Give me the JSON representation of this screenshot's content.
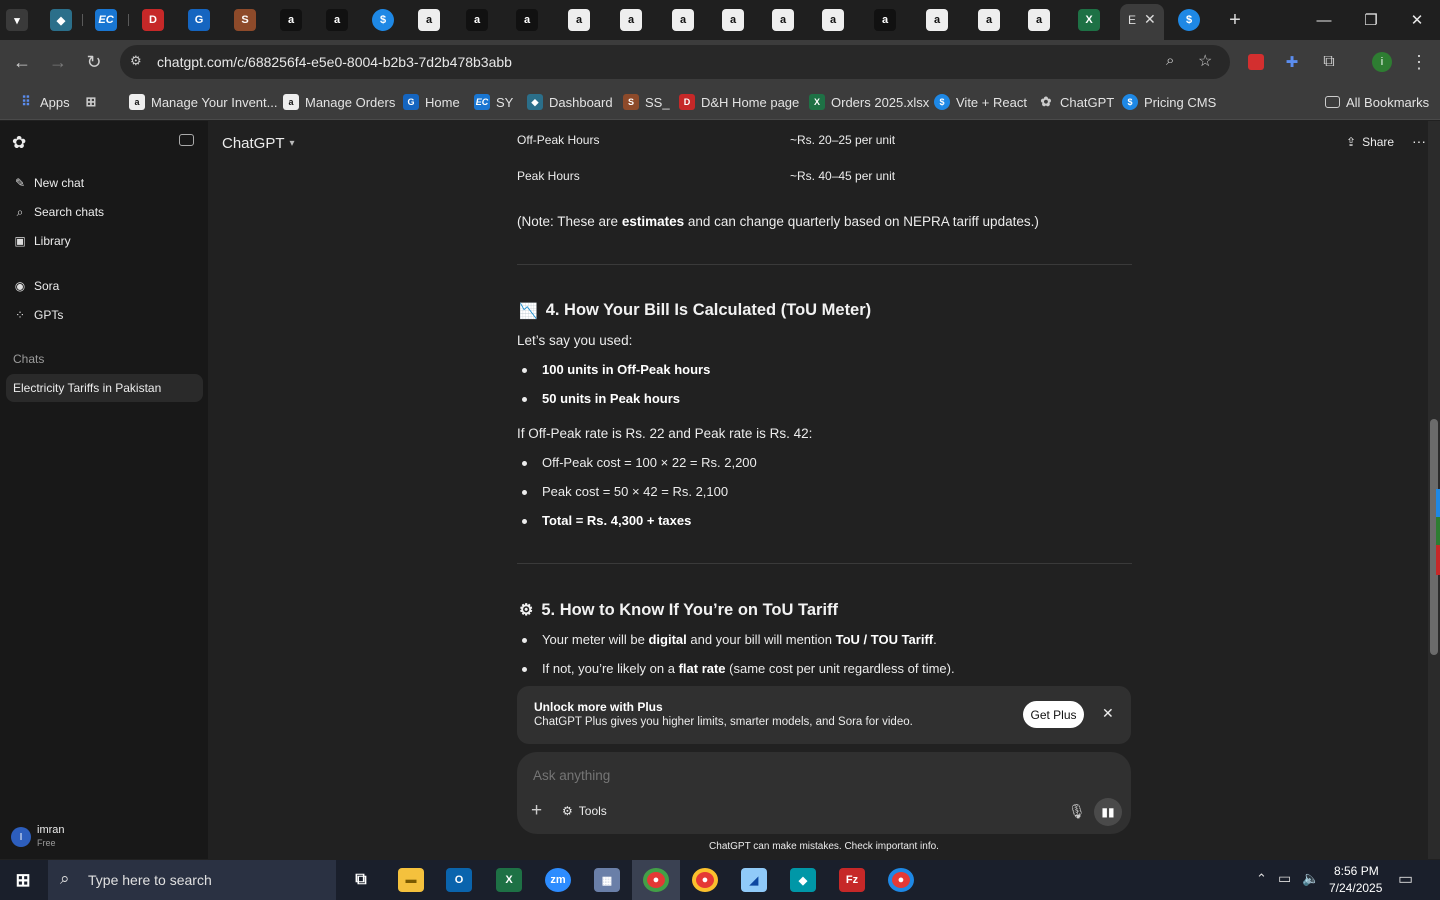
{
  "browser": {
    "url": "chatgpt.com/c/688256f4-e5e0-8004-b2b3-7d2b478b3abb",
    "active_tab_label": "E",
    "bookmarks": [
      {
        "label": "Apps",
        "icon": "apps-grid-icon"
      },
      {
        "label": "",
        "icon": "tab-groups-icon"
      },
      {
        "label": "Manage Your Invent...",
        "icon": "amazon-icon"
      },
      {
        "label": "Manage Orders",
        "icon": "amazon-icon"
      },
      {
        "label": "Home",
        "icon": "home-site-icon"
      },
      {
        "label": "SY",
        "icon": "ec-icon"
      },
      {
        "label": "Dashboard",
        "icon": "dashboard-icon"
      },
      {
        "label": "SS_",
        "icon": "ss-icon"
      },
      {
        "label": "D&H Home page",
        "icon": "dh-icon"
      },
      {
        "label": "Orders 2025.xlsx",
        "icon": "excel-icon"
      },
      {
        "label": "Vite + React",
        "icon": "vite-icon"
      },
      {
        "label": "ChatGPT",
        "icon": "openai-icon"
      },
      {
        "label": "Pricing CMS",
        "icon": "pricing-icon"
      }
    ],
    "all_bookmarks_label": "All Bookmarks"
  },
  "sidebar": {
    "new_chat": "New chat",
    "search_chats": "Search chats",
    "library": "Library",
    "sora": "Sora",
    "gpts": "GPTs",
    "chats_header": "Chats",
    "active_chat": "Electricity Tariffs in Pakistan",
    "user": {
      "initial": "I",
      "name": "imran",
      "plan": "Free"
    }
  },
  "header": {
    "model": "ChatGPT",
    "share": "Share"
  },
  "table_rows": [
    {
      "period": "Off-Peak Hours",
      "rate": "~Rs. 20–25 per unit"
    },
    {
      "period": "Peak Hours",
      "rate": "~Rs. 40–45 per unit"
    }
  ],
  "note": {
    "prefix": "(Note: These are ",
    "bold": "estimates",
    "suffix": " and can change quarterly based on NEPRA tariff updates.)"
  },
  "section4": {
    "emoji": "📉",
    "title": "4. How Your Bill Is Calculated (ToU Meter)",
    "intro": "Let’s say you used:",
    "usage": [
      "100 units in Off-Peak hours",
      "50 units in Peak hours"
    ],
    "rates_line": "If Off-Peak rate is Rs. 22 and Peak rate is Rs. 42:",
    "costs": [
      "Off-Peak cost = 100 × 22 = Rs. 2,200",
      "Peak cost = 50 × 42 = Rs. 2,100"
    ],
    "total": "Total = Rs. 4,300 + taxes"
  },
  "section5": {
    "emoji": "⚙",
    "title": "5. How to Know If You’re on ToU Tariff",
    "b1_pre": "Your meter will be ",
    "b1_bold1": "digital",
    "b1_mid": " and your bill will mention ",
    "b1_bold2": "ToU / TOU Tariff",
    "b1_end": ".",
    "b2_pre": "If not, you’re likely on a ",
    "b2_bold": "flat rate",
    "b2_end": " (same cost per unit regardless of time)."
  },
  "plus_banner": {
    "title": "Unlock more with Plus",
    "subtitle": "ChatGPT Plus gives you higher limits, smarter models, and Sora for video.",
    "button": "Get Plus"
  },
  "composer": {
    "placeholder": "Ask anything",
    "tools": "Tools"
  },
  "footer_note": "ChatGPT can make mistakes. Check important info.",
  "taskbar": {
    "search_placeholder": "Type here to search",
    "time": "8:56 PM",
    "date": "7/24/2025"
  },
  "colors": {
    "page_bg": "#212121",
    "sidebar_bg": "#181818",
    "accent_blue": "#2d5ebd"
  }
}
